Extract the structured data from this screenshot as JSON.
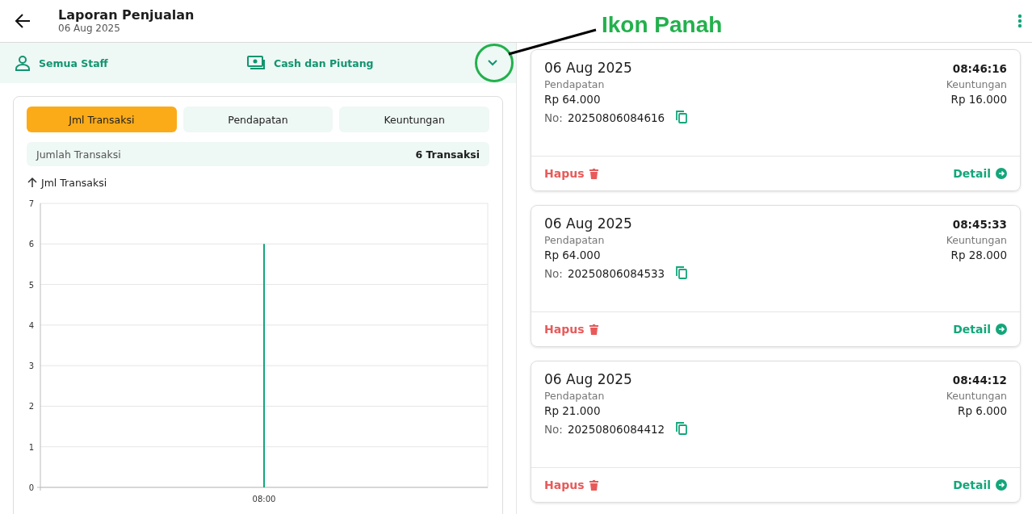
{
  "header": {
    "title": "Laporan Penjualan",
    "subtitle": "06 Aug 2025"
  },
  "filters": [
    {
      "kind": "staff",
      "label": "Semua Staff"
    },
    {
      "kind": "payment",
      "label": "Cash dan Piutang"
    }
  ],
  "annotation": {
    "label": "Ikon Panah"
  },
  "tabs": [
    {
      "label": "Jml Transaksi",
      "selected": true
    },
    {
      "label": "Pendapatan",
      "selected": false
    },
    {
      "label": "Keuntungan",
      "selected": false
    }
  ],
  "summary": {
    "label": "Jumlah Transaksi",
    "value": "6 Transaksi"
  },
  "chart_data": {
    "type": "bar",
    "ylabel": "Jml Transaksi",
    "categories": [
      "08:00"
    ],
    "values": [
      6
    ],
    "ylim": [
      0,
      7
    ],
    "grid": true,
    "yticks": [
      0,
      1,
      2,
      3,
      4,
      5,
      6,
      7
    ]
  },
  "transactions": [
    {
      "date": "06 Aug 2025",
      "time": "08:46:16",
      "income_label": "Pendapatan",
      "income": "Rp 64.000",
      "profit_label": "Keuntungan",
      "profit": "Rp 16.000",
      "no_label": "No:",
      "number": "20250806084616",
      "delete": "Hapus",
      "detail": "Detail"
    },
    {
      "date": "06 Aug 2025",
      "time": "08:45:33",
      "income_label": "Pendapatan",
      "income": "Rp 64.000",
      "profit_label": "Keuntungan",
      "profit": "Rp 28.000",
      "no_label": "No:",
      "number": "20250806084533",
      "delete": "Hapus",
      "detail": "Detail"
    },
    {
      "date": "06 Aug 2025",
      "time": "08:44:12",
      "income_label": "Pendapatan",
      "income": "Rp 21.000",
      "profit_label": "Keuntungan",
      "profit": "Rp 6.000",
      "no_label": "No:",
      "number": "20250806084412",
      "delete": "Hapus",
      "detail": "Detail"
    }
  ]
}
